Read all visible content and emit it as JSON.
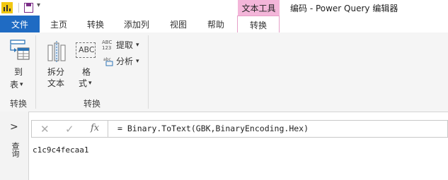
{
  "window": {
    "title": "编码 - Power Query 编辑器",
    "context_tab": "文本工具"
  },
  "tabs": [
    {
      "label": "文件"
    },
    {
      "label": "主页"
    },
    {
      "label": "转换"
    },
    {
      "label": "添加列"
    },
    {
      "label": "视图"
    },
    {
      "label": "帮助"
    },
    {
      "label": "转换"
    }
  ],
  "ribbon": {
    "to_table": {
      "line1": "到",
      "line2": "表",
      "dropdown": "▾"
    },
    "split_text": {
      "line1": "拆分",
      "line2": "文本"
    },
    "format": {
      "line1": "格",
      "line2": "式",
      "dropdown": "▾"
    },
    "extract": {
      "label": "提取",
      "dropdown": "▾",
      "icon_text": "ABC\n123"
    },
    "parse": {
      "label": "分析",
      "dropdown": "▾"
    },
    "format_icon_text": "ABC",
    "groups": [
      {
        "label": "转换"
      },
      {
        "label": "转换"
      }
    ]
  },
  "formula_bar": {
    "fx": "fx",
    "formula": "= Binary.ToText(GBK,BinaryEncoding.Hex)"
  },
  "left_pane": {
    "toggle": ">",
    "label": "查询"
  },
  "result": {
    "value": "c1c9c4fecaa1"
  },
  "colors": {
    "file_tab": "#1f6bc3",
    "context_tab": "#f3b6d9",
    "accent_blue": "#2e75b6"
  }
}
